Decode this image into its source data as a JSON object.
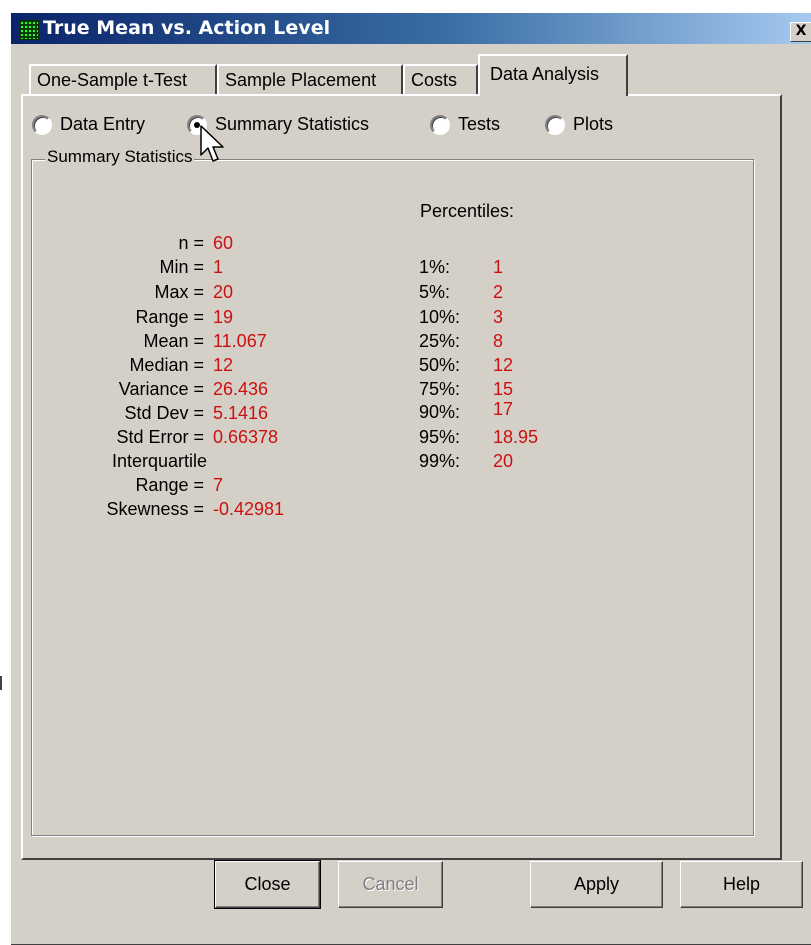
{
  "window": {
    "title": "True Mean vs. Action Level",
    "close_label": "X"
  },
  "tabs": [
    {
      "label": "One-Sample t-Test",
      "active": false
    },
    {
      "label": "Sample Placement",
      "active": false
    },
    {
      "label": "Costs",
      "active": false
    },
    {
      "label": "Data Analysis",
      "active": true
    }
  ],
  "view_options": [
    {
      "label": "Data Entry",
      "selected": false
    },
    {
      "label": "Summary Statistics",
      "selected": true
    },
    {
      "label": "Tests",
      "selected": false
    },
    {
      "label": "Plots",
      "selected": false
    }
  ],
  "summary": {
    "group_title": "Summary Statistics",
    "stats": [
      {
        "label": "n =",
        "value": "60"
      },
      {
        "label": "Min =",
        "value": "1"
      },
      {
        "label": "Max =",
        "value": "20"
      },
      {
        "label": "Range =",
        "value": "19"
      },
      {
        "label": "Mean =",
        "value": "11.067"
      },
      {
        "label": "Median =",
        "value": "12"
      },
      {
        "label": "Variance =",
        "value": "26.436"
      },
      {
        "label": "Std Dev =",
        "value": "5.1416"
      },
      {
        "label": "Std Error =",
        "value": "0.66378"
      },
      {
        "label": "Interquartile",
        "value": ""
      },
      {
        "label": "Range =",
        "value": "7"
      },
      {
        "label": "Skewness =",
        "value": "-0.42981"
      }
    ],
    "percentiles_title": "Percentiles:",
    "percentiles": [
      {
        "label": "1%:",
        "value": "1"
      },
      {
        "label": "5%:",
        "value": "2"
      },
      {
        "label": "10%:",
        "value": "3"
      },
      {
        "label": "25%:",
        "value": "8"
      },
      {
        "label": "50%:",
        "value": "12"
      },
      {
        "label": "75%:",
        "value": "15"
      },
      {
        "label": "90%:",
        "value": "17"
      },
      {
        "label": "95%:",
        "value": "18.95"
      },
      {
        "label": "99%:",
        "value": "20"
      }
    ]
  },
  "buttons": {
    "close": "Close",
    "cancel": "Cancel",
    "apply": "Apply",
    "help": "Help"
  },
  "colors": {
    "value_text": "#cc1010",
    "face": "#d4d0c8",
    "title_bar_start": "#0a246a",
    "title_bar_end": "#a6caf0"
  }
}
